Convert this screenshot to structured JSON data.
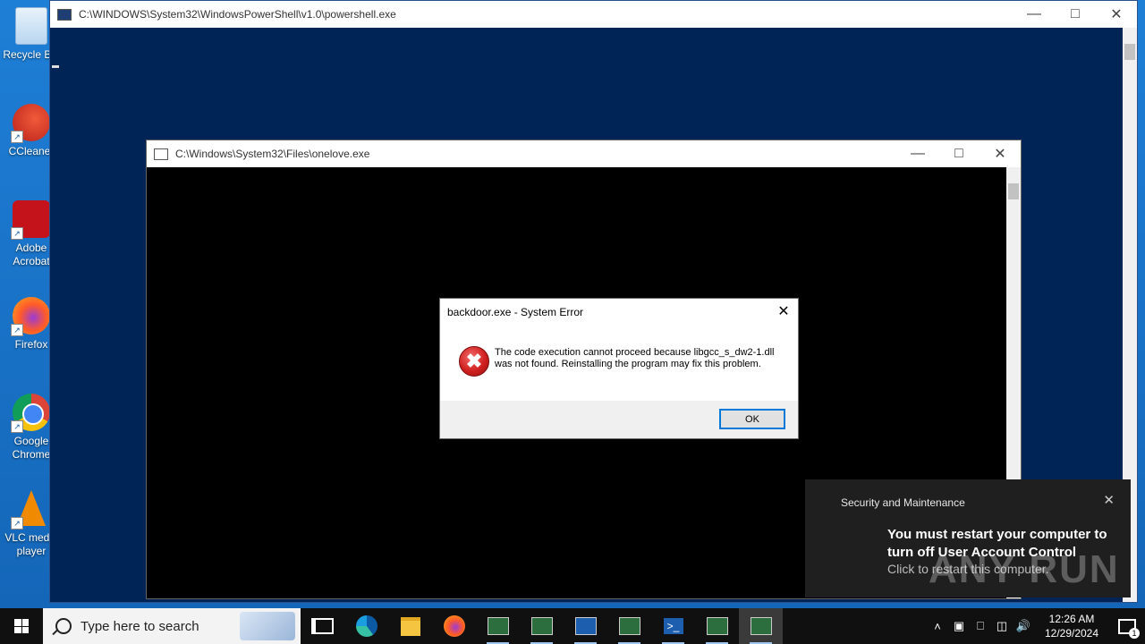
{
  "desktop": {
    "icons": [
      {
        "label": "Recycle Bin",
        "icon": "recycle-bin-icon",
        "color": "#cfe5f7"
      },
      {
        "label": "CCleaner",
        "icon": "ccleaner-icon",
        "color": "#d9362c"
      },
      {
        "label": "Adobe Acrobat",
        "icon": "acrobat-icon",
        "color": "#c4131a"
      },
      {
        "label": "Firefox",
        "icon": "firefox-icon",
        "color": "#ff7a1a"
      },
      {
        "label": "Google Chrome",
        "icon": "chrome-icon",
        "color": "#2c9a43"
      },
      {
        "label": "VLC media player",
        "icon": "vlc-icon",
        "color": "#f08a00"
      }
    ]
  },
  "powershell_window": {
    "title": "C:\\WINDOWS\\System32\\WindowsPowerShell\\v1.0\\powershell.exe",
    "background": "#012456"
  },
  "onelove_window": {
    "title": "C:\\Windows\\System32\\Files\\onelove.exe"
  },
  "error_dialog": {
    "title": "backdoor.exe - System Error",
    "message": "The code execution cannot proceed because libgcc_s_dw2-1.dll was not found. Reinstalling the program may fix this problem.",
    "ok_label": "OK",
    "icon": "error-icon"
  },
  "toast": {
    "app": "Security and Maintenance",
    "heading": "You must restart your computer to turn off User Account Control",
    "body": "Click to restart this computer."
  },
  "watermark": "ANY RUN",
  "taskbar": {
    "search_placeholder": "Type here to search",
    "apps": [
      "task-view-icon",
      "edge-icon",
      "file-explorer-icon",
      "firefox-icon",
      "console-window-icon",
      "console-window-icon",
      "console-window-icon",
      "console-window-icon",
      "powershell-icon",
      "console-window-icon",
      "console-window-icon"
    ],
    "clock_time": "12:26 AM",
    "clock_date": "12/29/2024",
    "notification_count": "1"
  }
}
